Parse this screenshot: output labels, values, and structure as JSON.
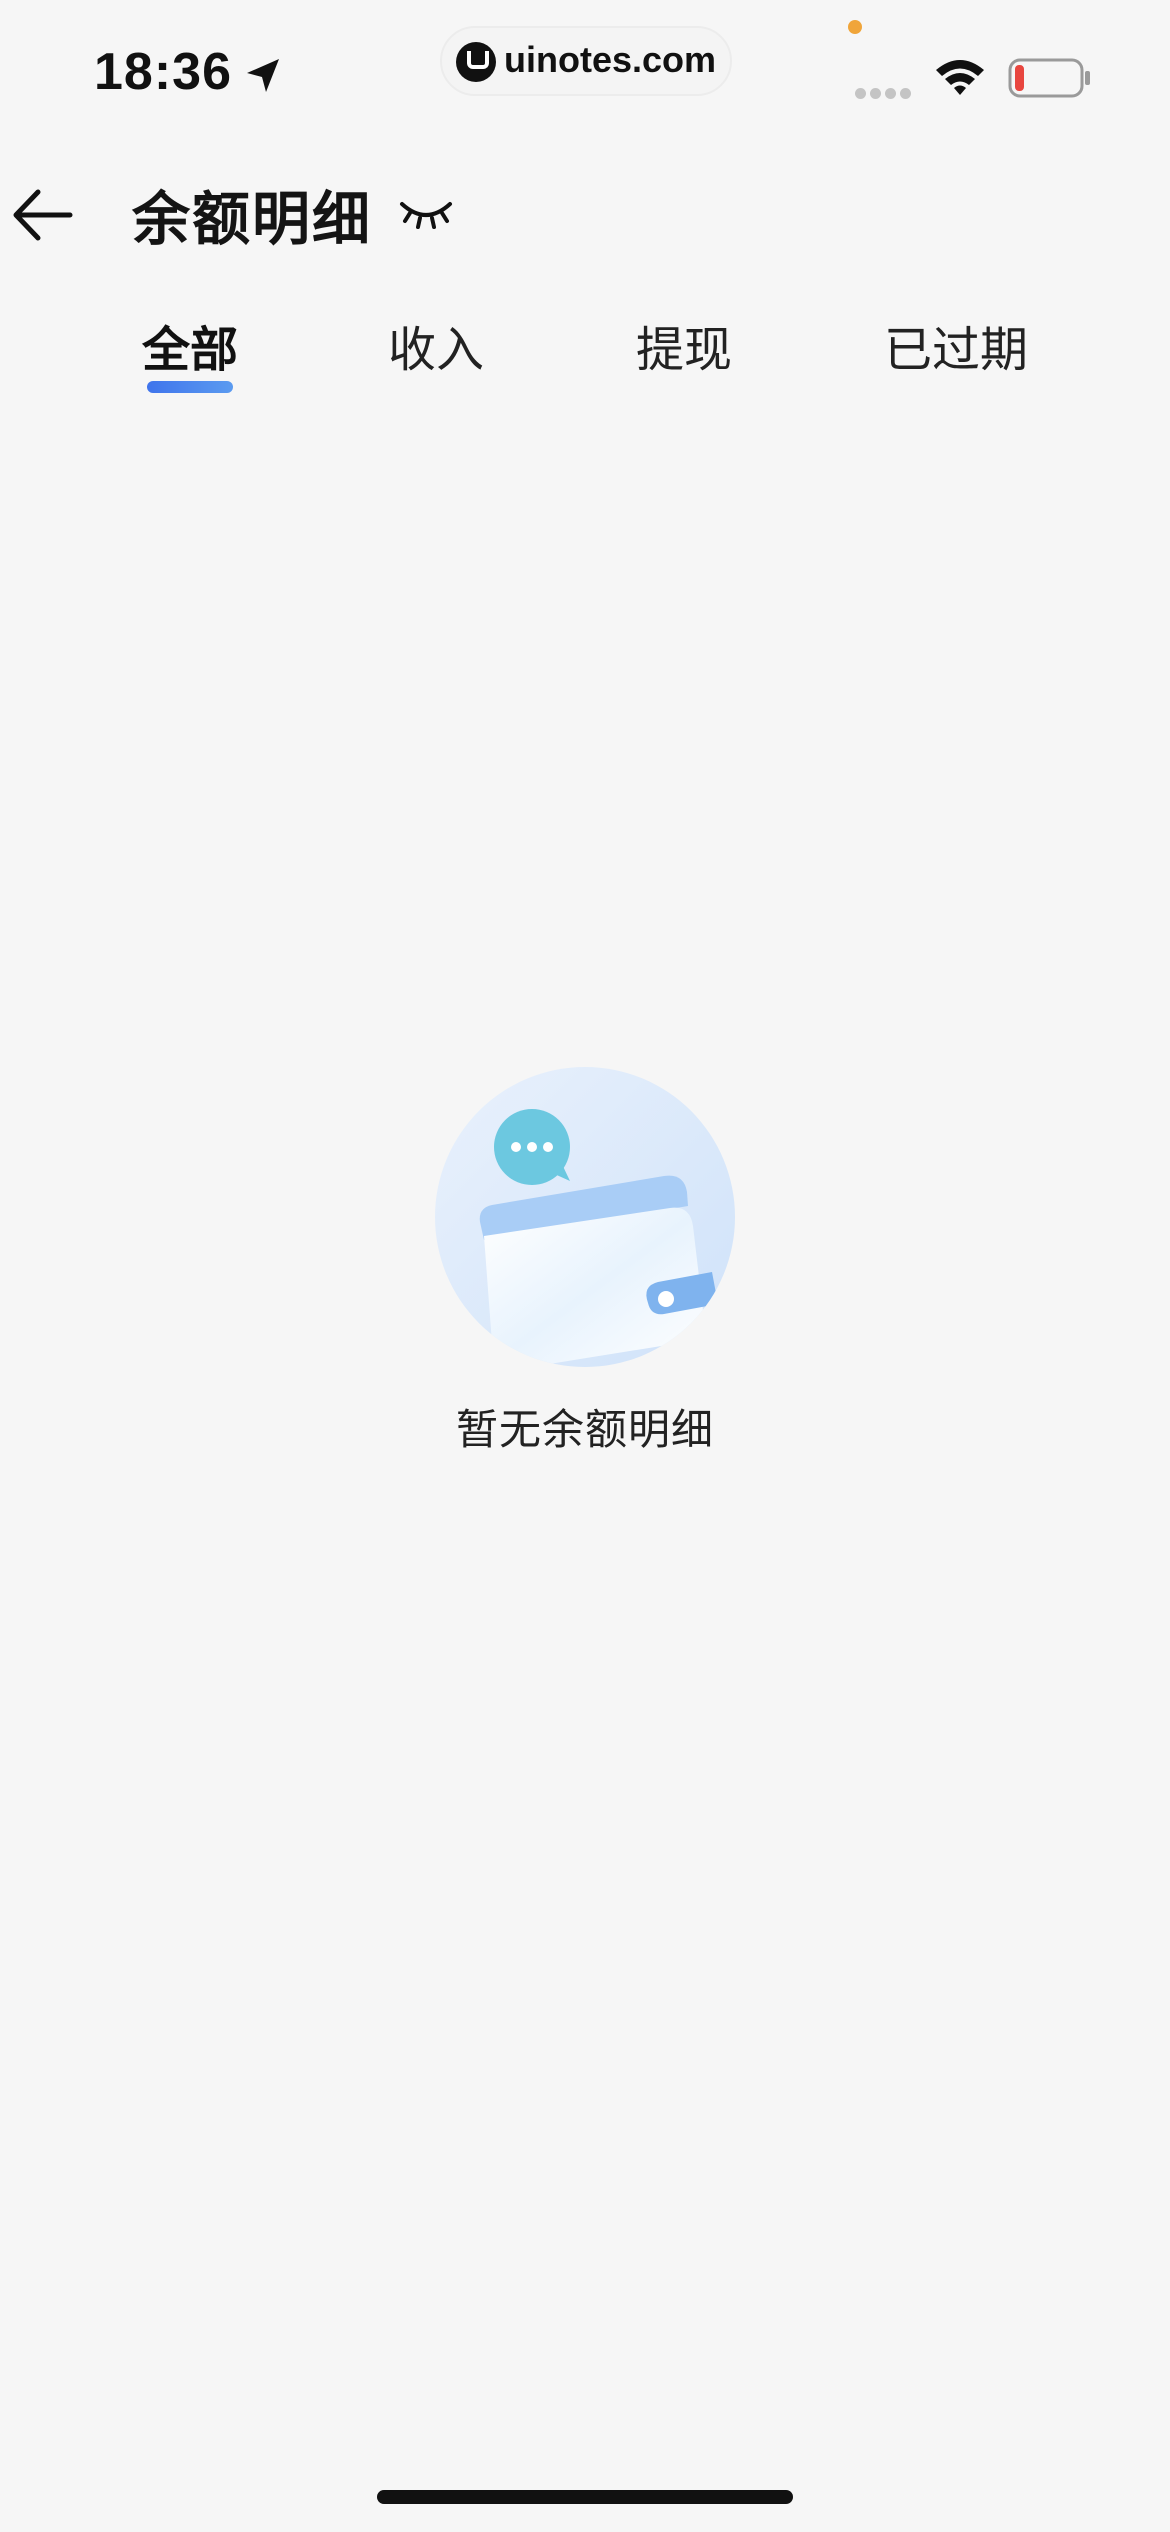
{
  "status_bar": {
    "time": "18:36",
    "url": "uinotes.com",
    "icons": [
      "location-arrow-icon",
      "wifi-icon",
      "battery-low-icon"
    ]
  },
  "header": {
    "title": "余额明细",
    "back_icon": "back-arrow-icon",
    "eye_icon": "eye-closed-icon"
  },
  "tabs": [
    {
      "label": "全部",
      "active": true
    },
    {
      "label": "收入",
      "active": false
    },
    {
      "label": "提现",
      "active": false
    },
    {
      "label": "已过期",
      "active": false
    }
  ],
  "empty_state": {
    "message": "暂无余额明细",
    "illustration": "wallet-chat-illustration"
  },
  "colors": {
    "accent": "#3f74ec",
    "background": "#f6f6f6",
    "battery_low": "#e8463f"
  }
}
